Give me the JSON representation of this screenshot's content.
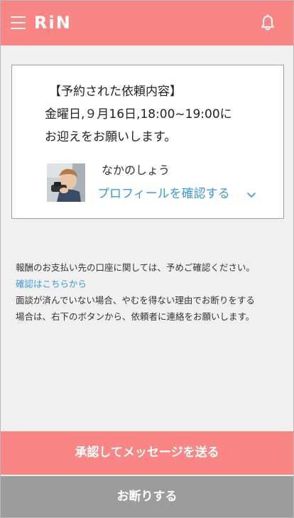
{
  "header": {
    "logo_text": "RiN",
    "menu_icon": "hamburger-menu-icon",
    "notification_icon": "bell-icon",
    "background_color": "#f98684"
  },
  "request_card": {
    "title": "【予約された依頼内容】",
    "line1": "金曜日,９月16日,18:00~19:00に",
    "line2": "お迎えをお願いします。",
    "user_name": "なかのしょう",
    "profile_link": "プロフィールを確認する",
    "chevron_icon": "chevron-down-icon"
  },
  "notes": {
    "line1": "報酬のお支払い先の口座に関しては、予めご確認ください。",
    "confirm_link": "確認はこちらから",
    "line2": "面談が済んでいない場合、やむを得ない理由でお断りをする",
    "line3": "場合は、右下のボタンから、依頼者に連絡をお願いします。"
  },
  "actions": {
    "approve_label": "承認してメッセージを送る",
    "decline_label": "お断りする",
    "approve_color": "#f98684",
    "decline_color": "#9c9c9c"
  },
  "colors": {
    "link": "#3a9ad9",
    "background": "#f0f0f0"
  }
}
